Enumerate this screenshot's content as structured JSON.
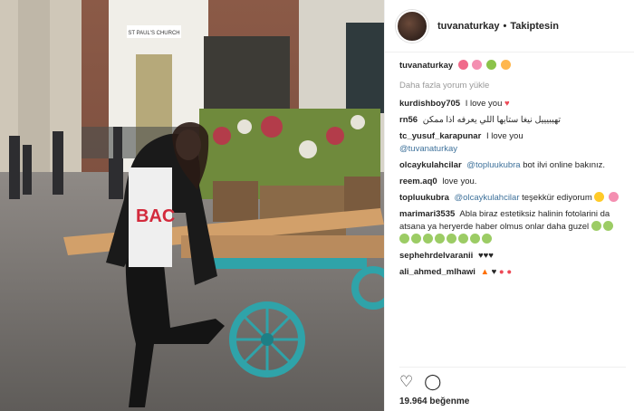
{
  "post": {
    "username": "tuvanaturkay",
    "follow_state": "Takiptesin",
    "caption_user": "tuvanaturkay",
    "load_more": "Daha fazla yorum yükle",
    "likes": "19.964 beğenme",
    "photo_sign": "ST PAUL'S CHURCH",
    "shirt_text": "BAC"
  },
  "comments": [
    {
      "user": "kurdishboy705",
      "text": "I love you"
    },
    {
      "user": "rn56",
      "text": "تهيبيييل نيغا ستايها اللي يعرفه اذا ممكن"
    },
    {
      "user": "tc_yusuf_karapunar",
      "text": "I love you",
      "mention": "@tuvanaturkay"
    },
    {
      "user": "olcaykulahcilar",
      "mention": "@topluukubra",
      "text": "bot ilvi online bakınız."
    },
    {
      "user": "reem.aq0",
      "text": "love you."
    },
    {
      "user": "topluukubra",
      "mention": "@olcaykulahcilar",
      "text": "teşekkür ediyorum"
    },
    {
      "user": "marimari3535",
      "text": "Abla biraz estetiksiz halinin fotolarini da atsana ya heryerde haber olmus onlar daha guzel"
    },
    {
      "user": "sephehrdelvaranii",
      "text": ""
    },
    {
      "user": "ali_ahmed_mlhawi",
      "text": ""
    }
  ],
  "colors": {
    "accent": "#3f729b",
    "heart": "#ed4956"
  }
}
